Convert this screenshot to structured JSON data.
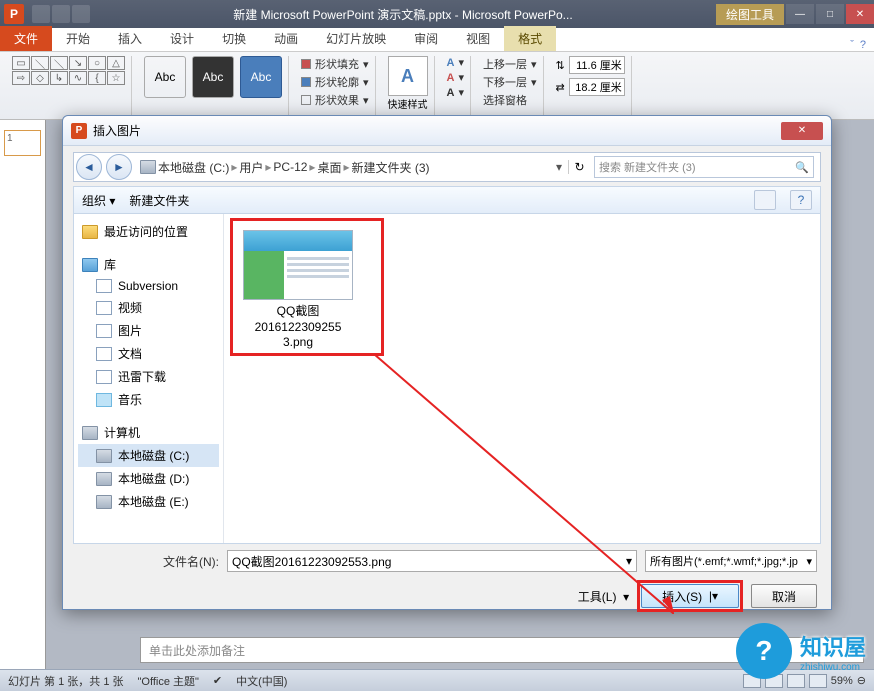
{
  "titlebar": {
    "doc_title": "新建 Microsoft PowerPoint 演示文稿.pptx - Microsoft PowerPo...",
    "context_tab": "绘图工具"
  },
  "tabs": {
    "file": "文件",
    "home": "开始",
    "insert": "插入",
    "design": "设计",
    "transition": "切换",
    "animation": "动画",
    "slideshow": "幻灯片放映",
    "review": "审阅",
    "view": "视图",
    "format": "格式"
  },
  "ribbon": {
    "abc": "Abc",
    "shape_fill": "形状填充",
    "shape_outline": "形状轮廓",
    "shape_effects": "形状效果",
    "quick_styles": "快速样式",
    "bring_forward": "上移一层",
    "send_backward": "下移一层",
    "selection_pane": "选择窗格",
    "width_val": "11.6 厘米",
    "height_val": "18.2 厘米"
  },
  "dialog": {
    "title": "插入图片",
    "crumbs": [
      "本地磁盘 (C:)",
      "用户",
      "PC-12",
      "桌面",
      "新建文件夹 (3)"
    ],
    "search_ph": "搜索 新建文件夹 (3)",
    "organize": "组织",
    "new_folder": "新建文件夹",
    "tree": {
      "recent": "最近访问的位置",
      "libraries": "库",
      "subversion": "Subversion",
      "videos": "视频",
      "pictures": "图片",
      "documents": "文档",
      "downloads": "迅雷下载",
      "music": "音乐",
      "computer": "计算机",
      "disk_c": "本地磁盘 (C:)",
      "disk_d": "本地磁盘 (D:)",
      "disk_e": "本地磁盘 (E:)"
    },
    "file": {
      "name_l1": "QQ截图",
      "name_l2": "2016122309255",
      "name_l3": "3.png"
    },
    "filename_label": "文件名(N):",
    "filename_value": "QQ截图20161223092553.png",
    "filter_value": "所有图片(*.emf;*.wmf;*.jpg;*.jp",
    "tools": "工具(L)",
    "insert_btn": "插入(S)",
    "cancel_btn": "取消"
  },
  "notes_placeholder": "单击此处添加备注",
  "status": {
    "slide": "幻灯片 第 1 张，共 1 张",
    "theme": "\"Office 主题\"",
    "lang": "中文(中国)",
    "zoom": "59%"
  },
  "thumb_num": "1",
  "watermark": {
    "brand": "知识屋",
    "url": "zhishiwu.com"
  }
}
